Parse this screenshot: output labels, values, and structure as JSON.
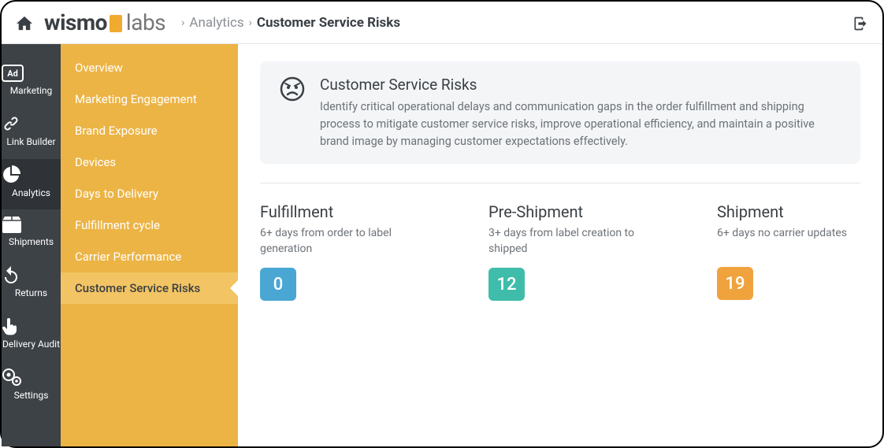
{
  "breadcrumb": {
    "section": "Analytics",
    "page": "Customer Service Risks"
  },
  "rail": {
    "items": [
      {
        "label": "Marketing"
      },
      {
        "label": "Link Builder"
      },
      {
        "label": "Analytics"
      },
      {
        "label": "Shipments"
      },
      {
        "label": "Returns"
      },
      {
        "label": "Delivery Audit"
      },
      {
        "label": "Settings"
      }
    ]
  },
  "subnav": {
    "items": [
      {
        "label": "Overview"
      },
      {
        "label": "Marketing Engagement"
      },
      {
        "label": "Brand Exposure"
      },
      {
        "label": "Devices"
      },
      {
        "label": "Days to Delivery"
      },
      {
        "label": "Fulfillment cycle"
      },
      {
        "label": "Carrier Performance"
      },
      {
        "label": "Customer Service Risks"
      }
    ]
  },
  "banner": {
    "title": "Customer Service Risks",
    "desc": "Identify critical operational delays and communication gaps in the order fulfillment and shipping process to mitigate customer service risks, improve operational efficiency, and maintain a positive brand image by managing customer expectations effectively."
  },
  "metrics": [
    {
      "title": "Fulfillment",
      "desc": "6+ days from order to label generation",
      "value": "0",
      "color": "m-blue"
    },
    {
      "title": "Pre-Shipment",
      "desc": "3+ days from label creation to shipped",
      "value": "12",
      "color": "m-teal"
    },
    {
      "title": "Shipment",
      "desc": "6+ days no carrier updates",
      "value": "19",
      "color": "m-orange"
    }
  ]
}
